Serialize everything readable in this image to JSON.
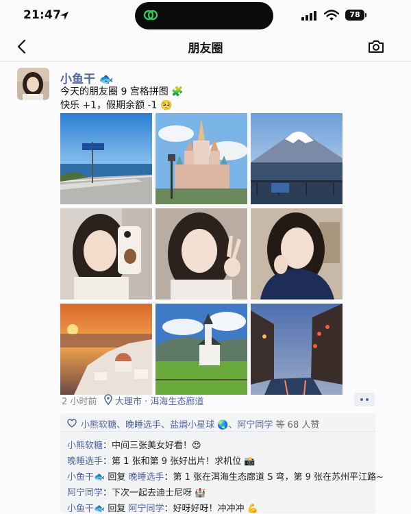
{
  "status": {
    "time": "21:47",
    "battery": "78"
  },
  "nav": {
    "title": "朋友圈"
  },
  "post": {
    "username": "小鱼干 🐟",
    "text_line1": "今天的朋友圈 9 宫格拼图 🧩",
    "text_line2": "快乐 +1，假期余额 -1 🥺",
    "photos": [
      {
        "subject": "seaside-road"
      },
      {
        "subject": "fairy-castle"
      },
      {
        "subject": "mount-fuji-lake"
      },
      {
        "subject": "selfie-mirror"
      },
      {
        "subject": "selfie-wink-peace"
      },
      {
        "subject": "selfie-sweater"
      },
      {
        "subject": "santorini-sunset"
      },
      {
        "subject": "meadow-chapel"
      },
      {
        "subject": "water-town-night"
      }
    ],
    "time_ago": "2 小时前",
    "location": "大理市 · 洱海生态廊道"
  },
  "likes": {
    "names": [
      "小熊软糖",
      "晚睡选手",
      "盐焗小星球 🌏",
      "阿宁同学"
    ],
    "separator": "、",
    "suffix": " 等 68 人赞"
  },
  "comments": [
    {
      "name": "小熊软糖",
      "reply_to": "",
      "text": "中间三张美女好看！😍"
    },
    {
      "name": "晚睡选手",
      "reply_to": "",
      "text": "第 1 张和第 9 张好出片！求机位 📸"
    },
    {
      "name": "小鱼干🐟",
      "reply_word": " 回复 ",
      "reply_to": "晚睡选手",
      "text": "第 1 张在洱海生态廊道 S 弯，第 9 张在苏州平江路~"
    },
    {
      "name": "阿宁同学",
      "reply_to": "",
      "text": "下次一起去迪士尼呀 🏰"
    },
    {
      "name": "小鱼干🐟",
      "reply_word": " 回复 ",
      "reply_to": "阿宁同学",
      "text": "好呀好呀！冲冲冲 💪"
    }
  ],
  "colors": {
    "link": "#54679e",
    "accent": "#34c759"
  }
}
